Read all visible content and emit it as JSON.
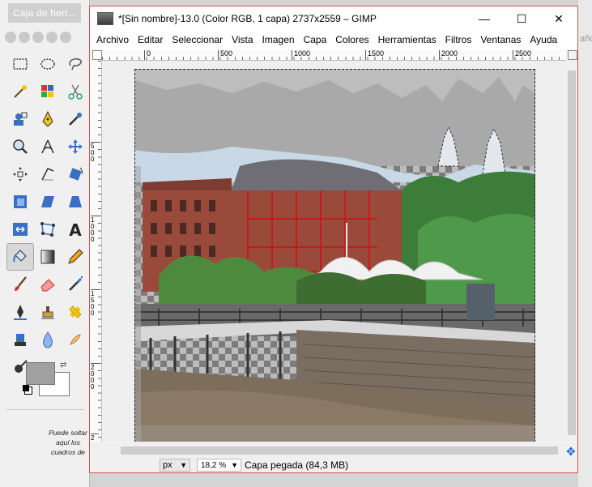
{
  "toolbox": {
    "title": "Caja de herr...",
    "drop_hint": "Puede soltar aquí los cuadros de"
  },
  "window": {
    "title": "*[Sin nombre]-13.0 (Color RGB, 1 capa) 2737x2559 – GIMP",
    "minimize": "—",
    "maximize": "☐",
    "close": "✕"
  },
  "menu": [
    "Archivo",
    "Editar",
    "Seleccionar",
    "Vista",
    "Imagen",
    "Capa",
    "Colores",
    "Herramientas",
    "Filtros",
    "Ventanas",
    "Ayuda"
  ],
  "ruler": {
    "h_ticks": [
      "0",
      "500",
      "1000",
      "1500",
      "2000",
      "2500"
    ],
    "v_ticks": [
      "5\n0\n0",
      "1\n0\n0\n0",
      "1\n5\n0\n0",
      "2\n0\n0\n0",
      "2"
    ]
  },
  "status": {
    "unit": "px",
    "zoom": "18,2 %",
    "layer_info": "Capa pegada (84,3 MB)"
  },
  "right_edge_text": "año",
  "colors": {
    "foreground": "#a0a0a0",
    "background": "#ffffff",
    "window_border": "#d9534f"
  }
}
